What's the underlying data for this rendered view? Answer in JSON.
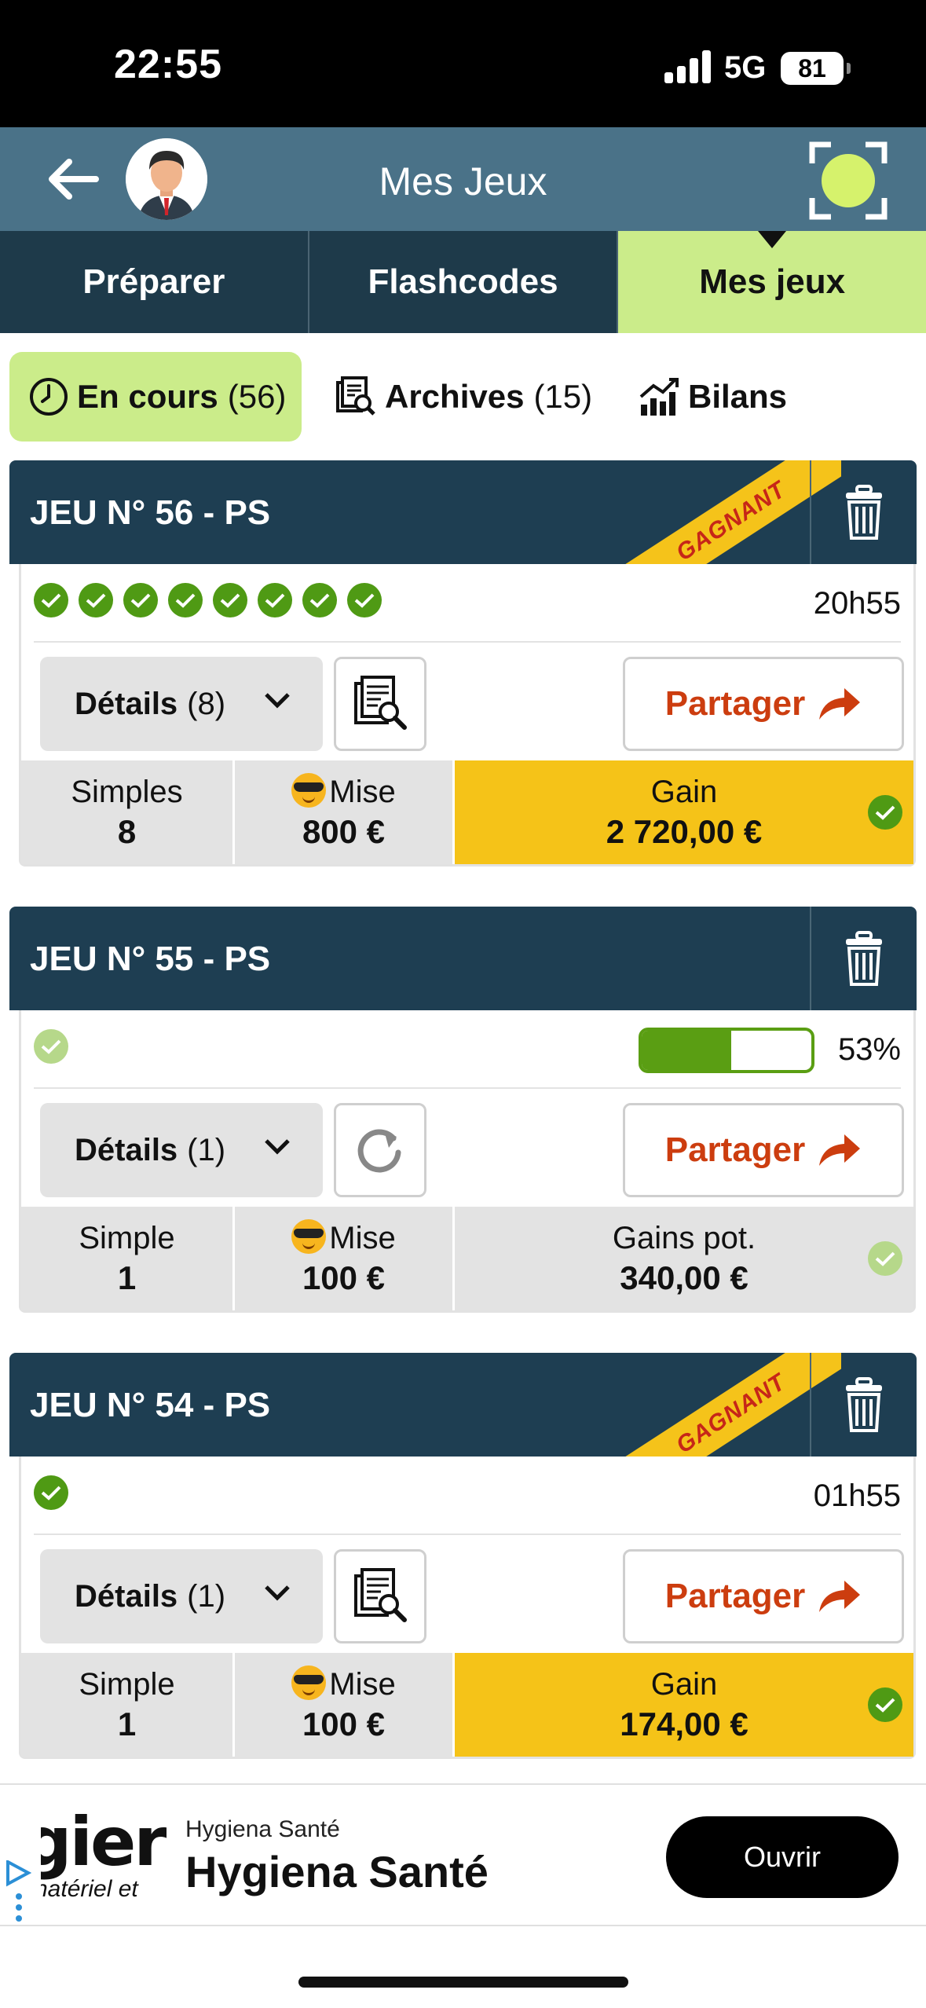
{
  "status_bar": {
    "time": "22:55",
    "network": "5G",
    "battery": "81"
  },
  "header": {
    "title": "Mes Jeux"
  },
  "main_tabs": [
    {
      "label": "Préparer"
    },
    {
      "label": "Flashcodes"
    },
    {
      "label": "Mes jeux"
    }
  ],
  "sub_tabs": {
    "en_cours": {
      "label": "En cours",
      "count": "(56)"
    },
    "archives": {
      "label": "Archives",
      "count": "(15)"
    },
    "bilans": {
      "label": "Bilans"
    }
  },
  "cards": [
    {
      "title": "JEU N° 56 - PS",
      "ribbon": "GAGNANT",
      "time": "20h55",
      "details_label": "Détails",
      "details_count": "(8)",
      "share_label": "Partager",
      "stat1_label": "Simples",
      "stat1_value": "8",
      "stat2_label": "Mise",
      "stat2_value": "800 €",
      "stat3_label": "Gain",
      "stat3_value": "2 720,00 €"
    },
    {
      "title": "JEU N° 55 - PS",
      "progress_percent": 53,
      "progress_label": "53%",
      "details_label": "Détails",
      "details_count": "(1)",
      "share_label": "Partager",
      "stat1_label": "Simple",
      "stat1_value": "1",
      "stat2_label": "Mise",
      "stat2_value": "100 €",
      "stat3_label": "Gains pot.",
      "stat3_value": "340,00 €"
    },
    {
      "title": "JEU N° 54 - PS",
      "ribbon": "GAGNANT",
      "time": "01h55",
      "details_label": "Détails",
      "details_count": "(1)",
      "share_label": "Partager",
      "stat1_label": "Simple",
      "stat1_value": "1",
      "stat2_label": "Mise",
      "stat2_value": "100 €",
      "stat3_label": "Gain",
      "stat3_value": "174,00 €"
    }
  ],
  "ad": {
    "logo_big": "gier",
    "logo_small": "natériel et",
    "small_title": "Hygiena Santé",
    "title": "Hygiena Santé",
    "button": "Ouvrir"
  },
  "colors": {
    "header": "#4a7288",
    "tabs": "#1e3a4a",
    "accent_green": "#cbec8a",
    "card_head": "#1e3e52",
    "gain_yellow": "#f5c318",
    "share_orange": "#cc3d0f",
    "check_green": "#4f9a14"
  }
}
